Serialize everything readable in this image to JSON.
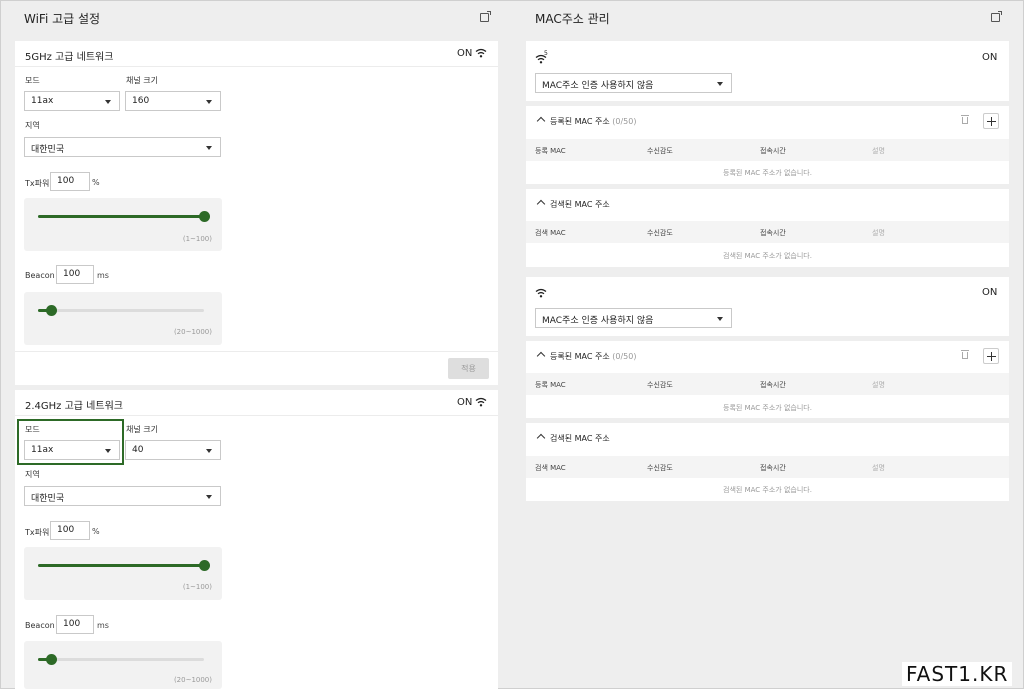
{
  "left": {
    "title": "WiFi 고급 설정",
    "net5": {
      "title": "5GHz 고급 네트워크",
      "status": "ON",
      "mode_label": "모드",
      "mode_value": "11ax",
      "channel_label": "채널 크기",
      "channel_value": "160",
      "region_label": "지역",
      "region_value": "대한민국",
      "tx_label": "Tx파워",
      "tx_value": "100",
      "tx_unit": "%",
      "tx_range": "(1~100)",
      "tx_level": 1.0,
      "beacon_label": "Beacon",
      "beacon_value": "100",
      "beacon_unit": "ms",
      "beacon_range": "(20~1000)",
      "beacon_level": 0.08,
      "apply_label": "적용"
    },
    "net24": {
      "title": "2.4GHz 고급 네트워크",
      "status": "ON",
      "mode_label": "모드",
      "mode_value": "11ax",
      "channel_label": "채널 크기",
      "channel_value": "40",
      "region_label": "지역",
      "region_value": "대한민국",
      "tx_label": "Tx파워",
      "tx_value": "100",
      "tx_unit": "%",
      "tx_range": "(1~100)",
      "tx_level": 1.0,
      "beacon_label": "Beacon",
      "beacon_value": "100",
      "beacon_unit": "ms",
      "beacon_range": "(20~1000)",
      "beacon_level": 0.08
    }
  },
  "right": {
    "title": "MAC주소 관리",
    "band5": {
      "band_mark": "5",
      "status": "ON",
      "auth_value": "MAC주소 인증 사용하지 않음",
      "registered_title": "등록된 MAC 주소",
      "registered_count": "(0/50)",
      "reg_cols": [
        "등록 MAC",
        "수신감도",
        "접속시간",
        "설명"
      ],
      "reg_empty": "등록된 MAC 주소가 없습니다.",
      "searched_title": "검색된 MAC 주소",
      "search_cols": [
        "검색 MAC",
        "수신감도",
        "접속시간",
        "설명"
      ],
      "search_empty": "검색된 MAC 주소가 없습니다."
    },
    "band24": {
      "status": "ON",
      "auth_value": "MAC주소 인증 사용하지 않음",
      "registered_title": "등록된 MAC 주소",
      "registered_count": "(0/50)",
      "reg_cols": [
        "등록 MAC",
        "수신감도",
        "접속시간",
        "설명"
      ],
      "reg_empty": "등록된 MAC 주소가 없습니다.",
      "searched_title": "검색된 MAC 주소",
      "search_cols": [
        "검색 MAC",
        "수신감도",
        "접속시간",
        "설명"
      ],
      "search_empty": "검색된 MAC 주소가 없습니다."
    }
  },
  "brand": "FAST1.KR",
  "colors": {
    "accent": "#2d6a27",
    "background": "#eeeeee",
    "card": "#ffffff"
  }
}
